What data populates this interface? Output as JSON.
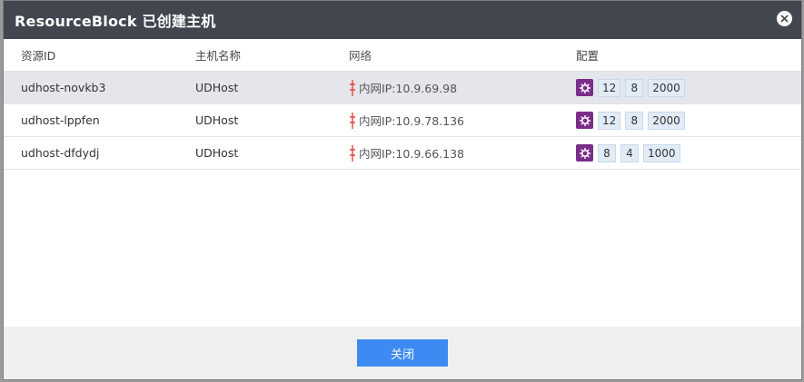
{
  "dialog": {
    "title": "ResourceBlock  已创建主机",
    "close_label": "关闭"
  },
  "table": {
    "headers": [
      "资源ID",
      "主机名称",
      "网络",
      "配置"
    ],
    "rows": [
      {
        "id": "udhost-novkb3",
        "name": "UDHost",
        "network": "内网IP:10.9.69.98",
        "cpu": "12",
        "mem": "8",
        "disk": "2000",
        "selected": true
      },
      {
        "id": "udhost-lppfen",
        "name": "UDHost",
        "network": "内网IP:10.9.78.136",
        "cpu": "12",
        "mem": "8",
        "disk": "2000",
        "selected": false
      },
      {
        "id": "udhost-dfdydj",
        "name": "UDHost",
        "network": "内网IP:10.9.66.138",
        "cpu": "8",
        "mem": "4",
        "disk": "1000",
        "selected": false
      }
    ]
  },
  "colors": {
    "header_bg": "#41464f",
    "button_bg": "#3d8bf2",
    "config_icon_bg": "#7b2d8a",
    "network_icon": "#e0463c"
  },
  "icons": {
    "close": "close-circle-icon",
    "network": "network-plug-icon",
    "config": "gear-icon"
  }
}
